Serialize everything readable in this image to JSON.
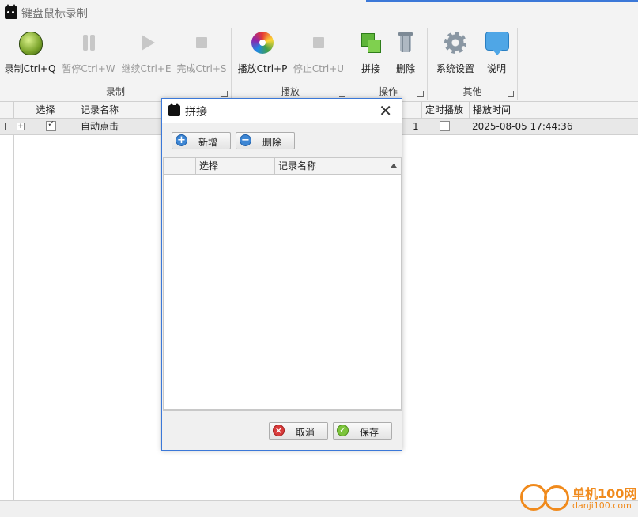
{
  "window": {
    "title": "键盘鼠标录制"
  },
  "ribbon": {
    "groups": [
      {
        "name": "录制",
        "buttons": [
          {
            "label": "录制Ctrl+Q",
            "icon": "bug-icon",
            "enabled": true
          },
          {
            "label": "暂停Ctrl+W",
            "icon": "pause-icon",
            "enabled": false
          },
          {
            "label": "继续Ctrl+E",
            "icon": "play-icon",
            "enabled": false
          },
          {
            "label": "完成Ctrl+S",
            "icon": "stop-icon",
            "enabled": false
          }
        ]
      },
      {
        "name": "播放",
        "buttons": [
          {
            "label": "播放Ctrl+P",
            "icon": "disc-icon",
            "enabled": true
          },
          {
            "label": "停止Ctrl+U",
            "icon": "stop-icon",
            "enabled": false
          }
        ]
      },
      {
        "name": "操作",
        "buttons": [
          {
            "label": "拼接",
            "icon": "merge-icon",
            "enabled": true
          },
          {
            "label": "删除",
            "icon": "trash-icon",
            "enabled": true
          }
        ]
      },
      {
        "name": "其他",
        "buttons": [
          {
            "label": "系统设置",
            "icon": "gear-icon",
            "enabled": true
          },
          {
            "label": "说明",
            "icon": "chat-bubble-icon",
            "enabled": true
          }
        ]
      }
    ]
  },
  "grid": {
    "columns": {
      "select": "选择",
      "name": "记录名称",
      "scheduled": "定时播放",
      "play_time": "播放时间"
    },
    "rows": [
      {
        "indicator": "I",
        "checked": true,
        "name": "自动点击",
        "count": "1",
        "scheduled": false,
        "play_time": "2025-08-05 17:44:36"
      }
    ]
  },
  "dialog": {
    "title": "拼接",
    "add_label": "新增",
    "delete_label": "删除",
    "columns": {
      "select": "选择",
      "name": "记录名称"
    },
    "cancel_label": "取消",
    "save_label": "保存"
  },
  "watermark": {
    "brand": "单机100网",
    "url": "danji100.com"
  },
  "colors": {
    "accent": "#3b78d8",
    "watermark": "#f08a1c"
  }
}
